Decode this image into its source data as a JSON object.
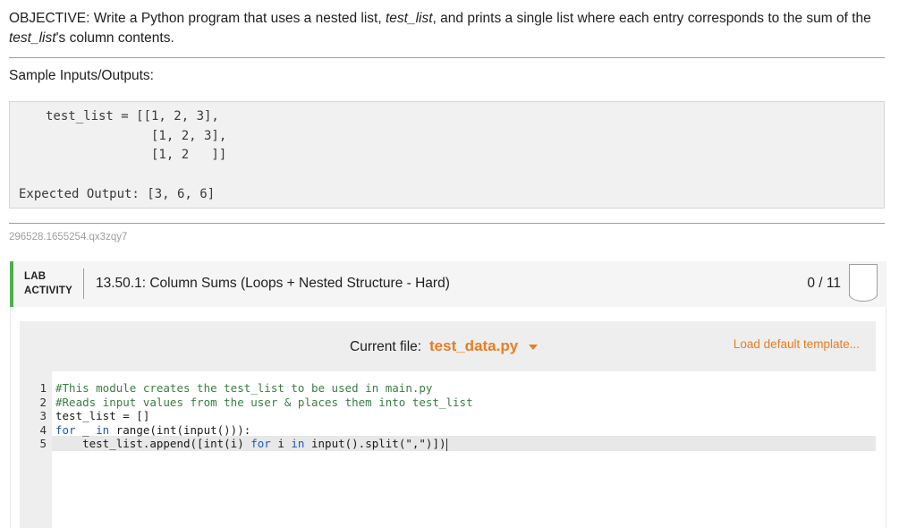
{
  "objective": {
    "label": "OBJECTIVE:",
    "text_1": " Write a Python program that uses a nested list, ",
    "var_1": "test_list",
    "text_2": ", and prints a single list where each entry corresponds to the sum of the",
    "var_2": "test_list",
    "text_3": "'s column contents."
  },
  "sample": {
    "title": "Sample Inputs/Outputs:",
    "lines": [
      "test_list = [[1, 2, 3],",
      "              [1, 2, 3],",
      "              [1, 2   ]]"
    ],
    "expected": "Expected Output: [3, 6, 6]"
  },
  "hash": "296528.1655254.qx3zqy7",
  "lab": {
    "label_line1": "LAB",
    "label_line2": "ACTIVITY",
    "title": "13.50.1: Column Sums (Loops + Nested Structure - Hard)",
    "score": "0 / 11"
  },
  "editor": {
    "current_file_label": "Current file:",
    "current_file": "test_data.py",
    "load_template": "Load default template...",
    "line_numbers": [
      "1",
      "2",
      "3",
      "4",
      "5"
    ],
    "lines": {
      "l1": "#This module creates the test_list to be used in main.py",
      "l2": "#Reads input values from the user & places them into test_list",
      "l3_a": "test_list = []",
      "l4_kw1": "for",
      "l4_mid": " _ ",
      "l4_kw2": "in",
      "l4_rest": " range(int(input())):",
      "l5_a": "    test_list.append([int(i) ",
      "l5_kw1": "for",
      "l5_b": " i ",
      "l5_kw2": "in",
      "l5_c": " input().split(\",\")])"
    }
  }
}
